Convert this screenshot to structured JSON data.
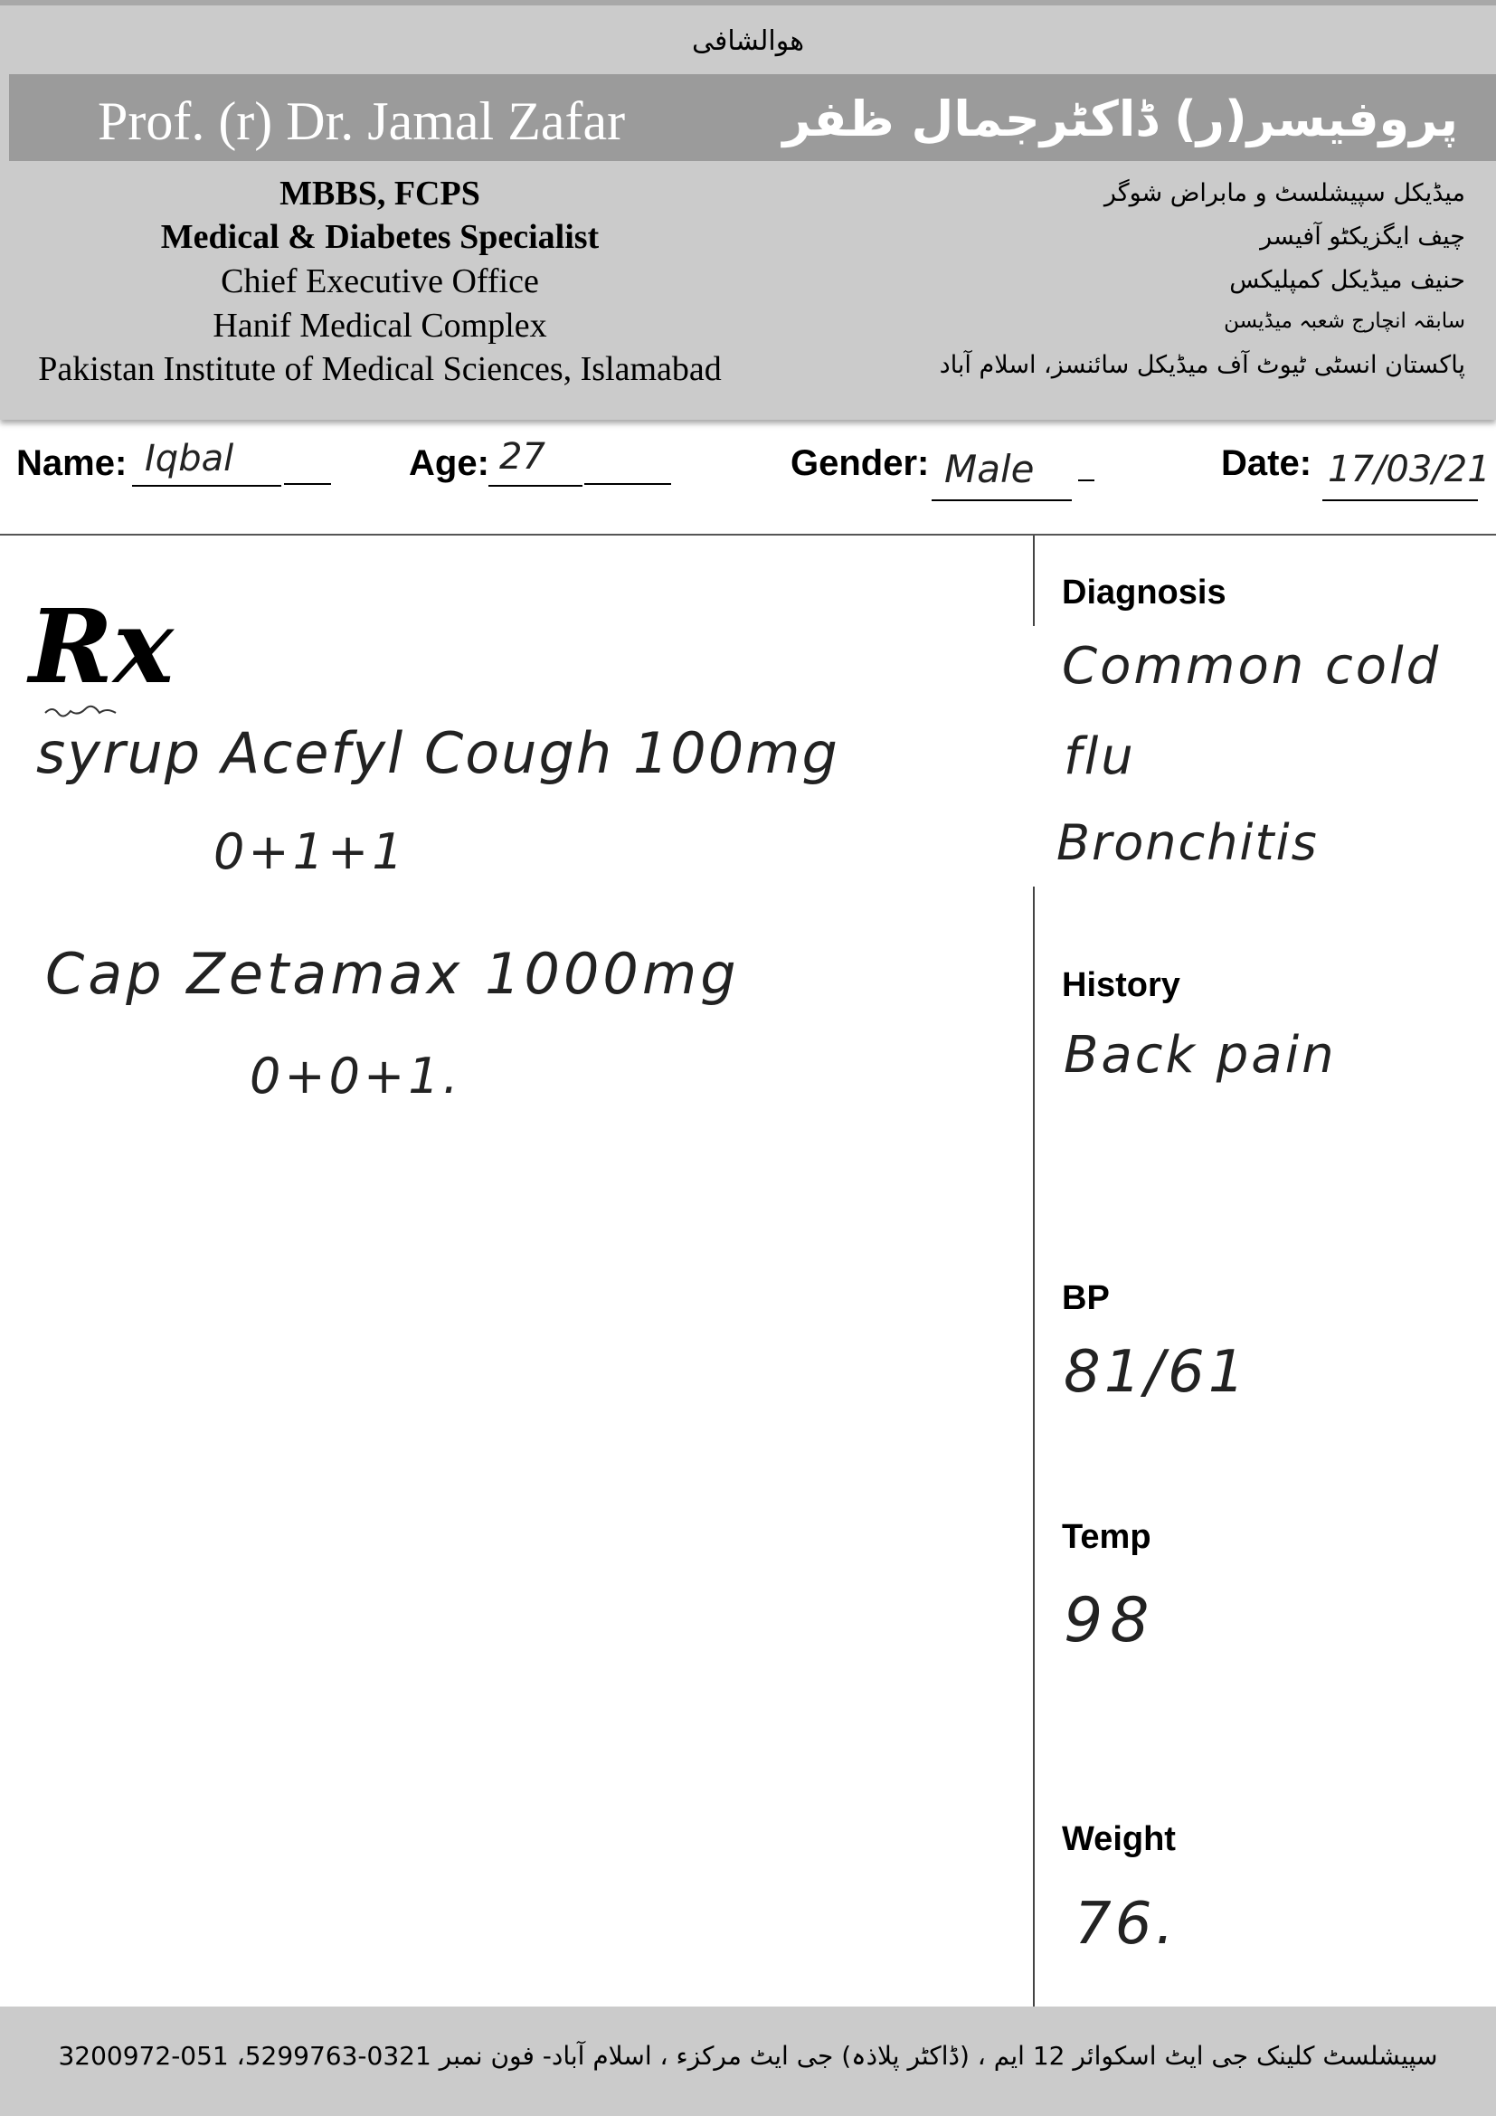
{
  "header": {
    "bismillah": "هوالشافی",
    "doctor_name_en": "Prof. (r) Dr. Jamal Zafar",
    "doctor_name_ur": "پروفیسر(ر) ڈاکٹرجمال ظفر",
    "credentials_en": [
      "MBBS, FCPS",
      "Medical & Diabetes Specialist",
      "Chief Executive Office",
      "Hanif Medical Complex",
      "Pakistan Institute of Medical Sciences, Islamabad"
    ],
    "credentials_ur": [
      "میڈیکل سپیشلسٹ و مابراض شوگر",
      "چیف ایگزیکٹو آفیسر",
      "حنیف میڈیکل کمپلیکس",
      "سابقہ انچارج شعبہ میڈیسن",
      "پاکستان انسٹی ٹیوٹ آف میڈیکل سائنسز، اسلام آباد"
    ]
  },
  "patient": {
    "name_label": "Name:",
    "name_value": "Iqbal",
    "age_label": "Age:",
    "age_value": "27",
    "gender_label": "Gender:",
    "gender_value": "Male",
    "date_label": "Date:",
    "date_value": "17/03/21"
  },
  "prescription": {
    "rx_symbol": "Rx",
    "lines": [
      "syrup  Acefyl Cough  100mg",
      "0+1+1",
      "Cap  Zetamax  1000mg",
      "0+0+1."
    ]
  },
  "sidebar": {
    "diagnosis_label": "Diagnosis",
    "diagnosis_values": [
      "Common cold",
      "flu",
      "Bronchitis"
    ],
    "history_label": "History",
    "history_value": "Back pain",
    "bp_label": "BP",
    "bp_value": "81/61",
    "temp_label": "Temp",
    "temp_value": "98",
    "weight_label": "Weight",
    "weight_value": "76."
  },
  "footer": {
    "address": "سپیشلسٹ کلینک جی ایٹ اسکوائر 12 ایم ، (ڈاکٹر پلاذہ) جی ایٹ مرکزء ، اسلام آباد- فون نمبر 0321-5299763، 051-3200972"
  }
}
